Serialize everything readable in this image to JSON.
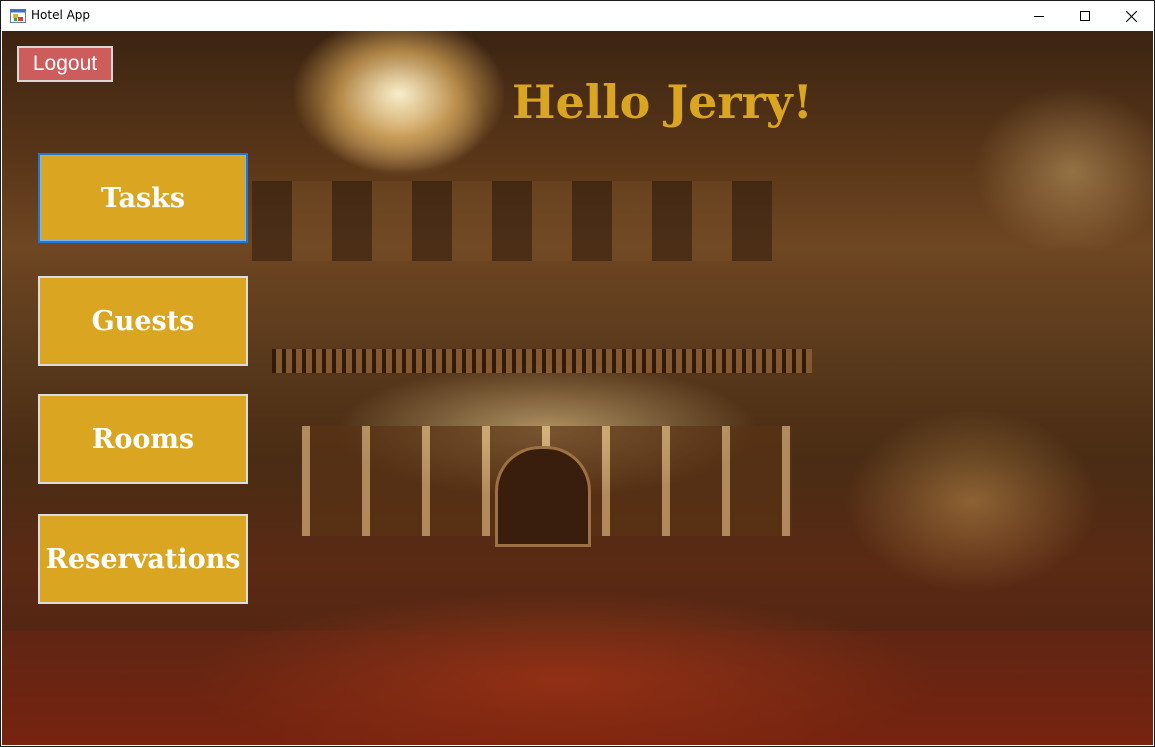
{
  "window": {
    "title": "Hotel App",
    "controls": {
      "minimize_glyph": "—",
      "maximize_glyph": "☐",
      "close_glyph": "✕"
    }
  },
  "header": {
    "logout_label": "Logout",
    "greeting": "Hello Jerry!"
  },
  "nav": {
    "items": [
      {
        "label": "Tasks",
        "focused": true
      },
      {
        "label": "Guests"
      },
      {
        "label": "Rooms"
      },
      {
        "label": "Reservations"
      }
    ]
  },
  "colors": {
    "gold_button": "#daa520",
    "logout_button": "#cd5c5c",
    "greeting_text": "#daa520",
    "focus_border": "#1e78d7"
  },
  "background": {
    "icon_name": "hotel-lobby-image"
  }
}
